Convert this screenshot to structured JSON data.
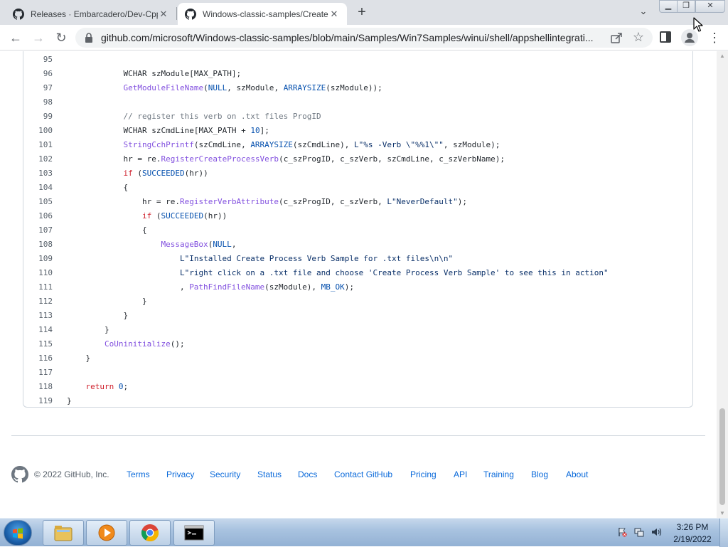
{
  "browser": {
    "tabs": [
      {
        "title": "Releases · Embarcadero/Dev-Cpp",
        "icon": "github-icon",
        "active": false
      },
      {
        "title": "Windows-classic-samples/Create",
        "icon": "github-icon",
        "active": true
      }
    ],
    "new_tab_label": "+",
    "url": "github.com/microsoft/Windows-classic-samples/blob/main/Samples/Win7Samples/winui/shell/appshellintegrati..."
  },
  "code": {
    "lines": [
      {
        "n": "95",
        "text": ""
      },
      {
        "n": "96",
        "text": "            WCHAR szModule[MAX_PATH];"
      },
      {
        "n": "97",
        "text": "            GetModuleFileName(NULL, szModule, ARRAYSIZE(szModule));"
      },
      {
        "n": "98",
        "text": ""
      },
      {
        "n": "99",
        "text": "            // register this verb on .txt files ProgID"
      },
      {
        "n": "100",
        "text": "            WCHAR szCmdLine[MAX_PATH + 10];"
      },
      {
        "n": "101",
        "text": "            StringCchPrintf(szCmdLine, ARRAYSIZE(szCmdLine), L\"%s -Verb \\\"%%1\\\"\", szModule);"
      },
      {
        "n": "102",
        "text": "            hr = re.RegisterCreateProcessVerb(c_szProgID, c_szVerb, szCmdLine, c_szVerbName);"
      },
      {
        "n": "103",
        "text": "            if (SUCCEEDED(hr))"
      },
      {
        "n": "104",
        "text": "            {"
      },
      {
        "n": "105",
        "text": "                hr = re.RegisterVerbAttribute(c_szProgID, c_szVerb, L\"NeverDefault\");"
      },
      {
        "n": "106",
        "text": "                if (SUCCEEDED(hr))"
      },
      {
        "n": "107",
        "text": "                {"
      },
      {
        "n": "108",
        "text": "                    MessageBox(NULL,"
      },
      {
        "n": "109",
        "text": "                        L\"Installed Create Process Verb Sample for .txt files\\n\\n\""
      },
      {
        "n": "110",
        "text": "                        L\"right click on a .txt file and choose 'Create Process Verb Sample' to see this in action\""
      },
      {
        "n": "111",
        "text": "                        , PathFindFileName(szModule), MB_OK);"
      },
      {
        "n": "112",
        "text": "                }"
      },
      {
        "n": "113",
        "text": "            }"
      },
      {
        "n": "114",
        "text": "        }"
      },
      {
        "n": "115",
        "text": "        CoUninitialize();"
      },
      {
        "n": "116",
        "text": "    }"
      },
      {
        "n": "117",
        "text": ""
      },
      {
        "n": "118",
        "text": "    return 0;"
      },
      {
        "n": "119",
        "text": "}"
      }
    ]
  },
  "footer": {
    "copyright": "© 2022 GitHub, Inc.",
    "links": [
      "Terms",
      "Privacy",
      "Security",
      "Status",
      "Docs",
      "Contact GitHub",
      "Pricing",
      "API",
      "Training",
      "Blog",
      "About"
    ]
  },
  "taskbar": {
    "apps": [
      "windows-explorer-icon",
      "media-player-icon",
      "chrome-icon",
      "command-prompt-icon"
    ],
    "time": "3:26 PM",
    "date": "2/19/2022"
  },
  "colors": {
    "keyword": "#cf222e",
    "function": "#8250df",
    "constant": "#0550ae",
    "string": "#0a3069",
    "comment": "#6e7781",
    "link": "#0969da"
  }
}
